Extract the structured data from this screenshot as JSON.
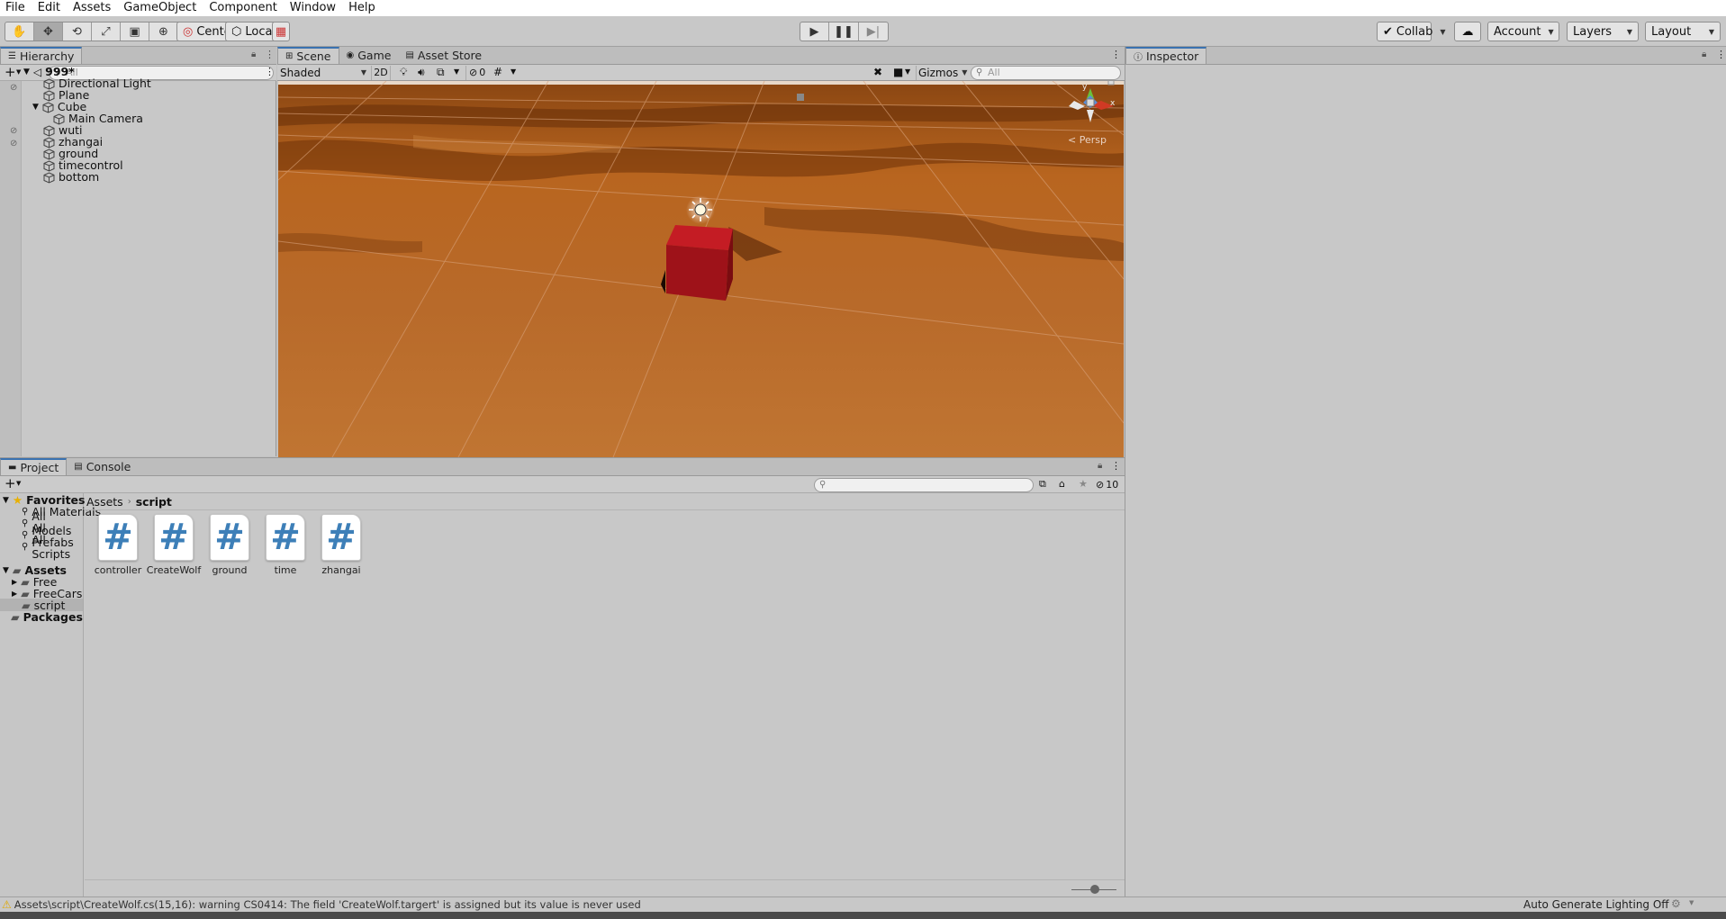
{
  "menu": [
    "File",
    "Edit",
    "Assets",
    "GameObject",
    "Component",
    "Window",
    "Help"
  ],
  "toolbar": {
    "tools": [
      "hand-icon",
      "move-icon",
      "rotate-icon",
      "scale-icon",
      "rect-icon",
      "transform-icon",
      "custom-tool-icon"
    ],
    "pivot_label": "Center",
    "space_label": "Local",
    "collab_label": "Collab",
    "account_label": "Account",
    "layers_label": "Layers",
    "layout_label": "Layout"
  },
  "hierarchy": {
    "tab_label": "Hierarchy",
    "search_placeholder": "All",
    "scene_name": "999*",
    "items": [
      {
        "label": "Directional Light"
      },
      {
        "label": "Plane"
      },
      {
        "label": "Cube"
      },
      {
        "label": "Main Camera"
      },
      {
        "label": "wuti"
      },
      {
        "label": "zhangai"
      },
      {
        "label": "ground"
      },
      {
        "label": "timecontrol"
      },
      {
        "label": "bottom"
      }
    ]
  },
  "scene_view": {
    "tabs": [
      "Scene",
      "Game",
      "Asset Store"
    ],
    "shading_mode": "Shaded",
    "mode_2d": "2D",
    "hidden_count": "0",
    "gizmos_label": "Gizmos",
    "search_placeholder": "All",
    "persp_label": "< Persp",
    "axis_x": "x",
    "axis_y": "y",
    "colors": {
      "terrain": "#b5641f",
      "cube": "#a4121a"
    }
  },
  "inspector": {
    "tab_label": "Inspector"
  },
  "project": {
    "tabs": [
      "Project",
      "Console"
    ],
    "hidden_count": "10",
    "favorites_label": "Favorites",
    "favorites": [
      "All Materials",
      "All Models",
      "All Prefabs",
      "All Scripts"
    ],
    "assets_label": "Assets",
    "asset_folders": [
      "Free",
      "FreeCars",
      "script"
    ],
    "packages_label": "Packages",
    "breadcrumb": [
      "Assets",
      "script"
    ],
    "files": [
      "controller",
      "CreateWolf",
      "ground",
      "time",
      "zhangai"
    ],
    "file_glyph": "#"
  },
  "status": {
    "warning": "Assets\\script\\CreateWolf.cs(15,16): warning CS0414: The field 'CreateWolf.targert' is assigned but its value is never used",
    "lighting": "Auto Generate Lighting Off"
  }
}
